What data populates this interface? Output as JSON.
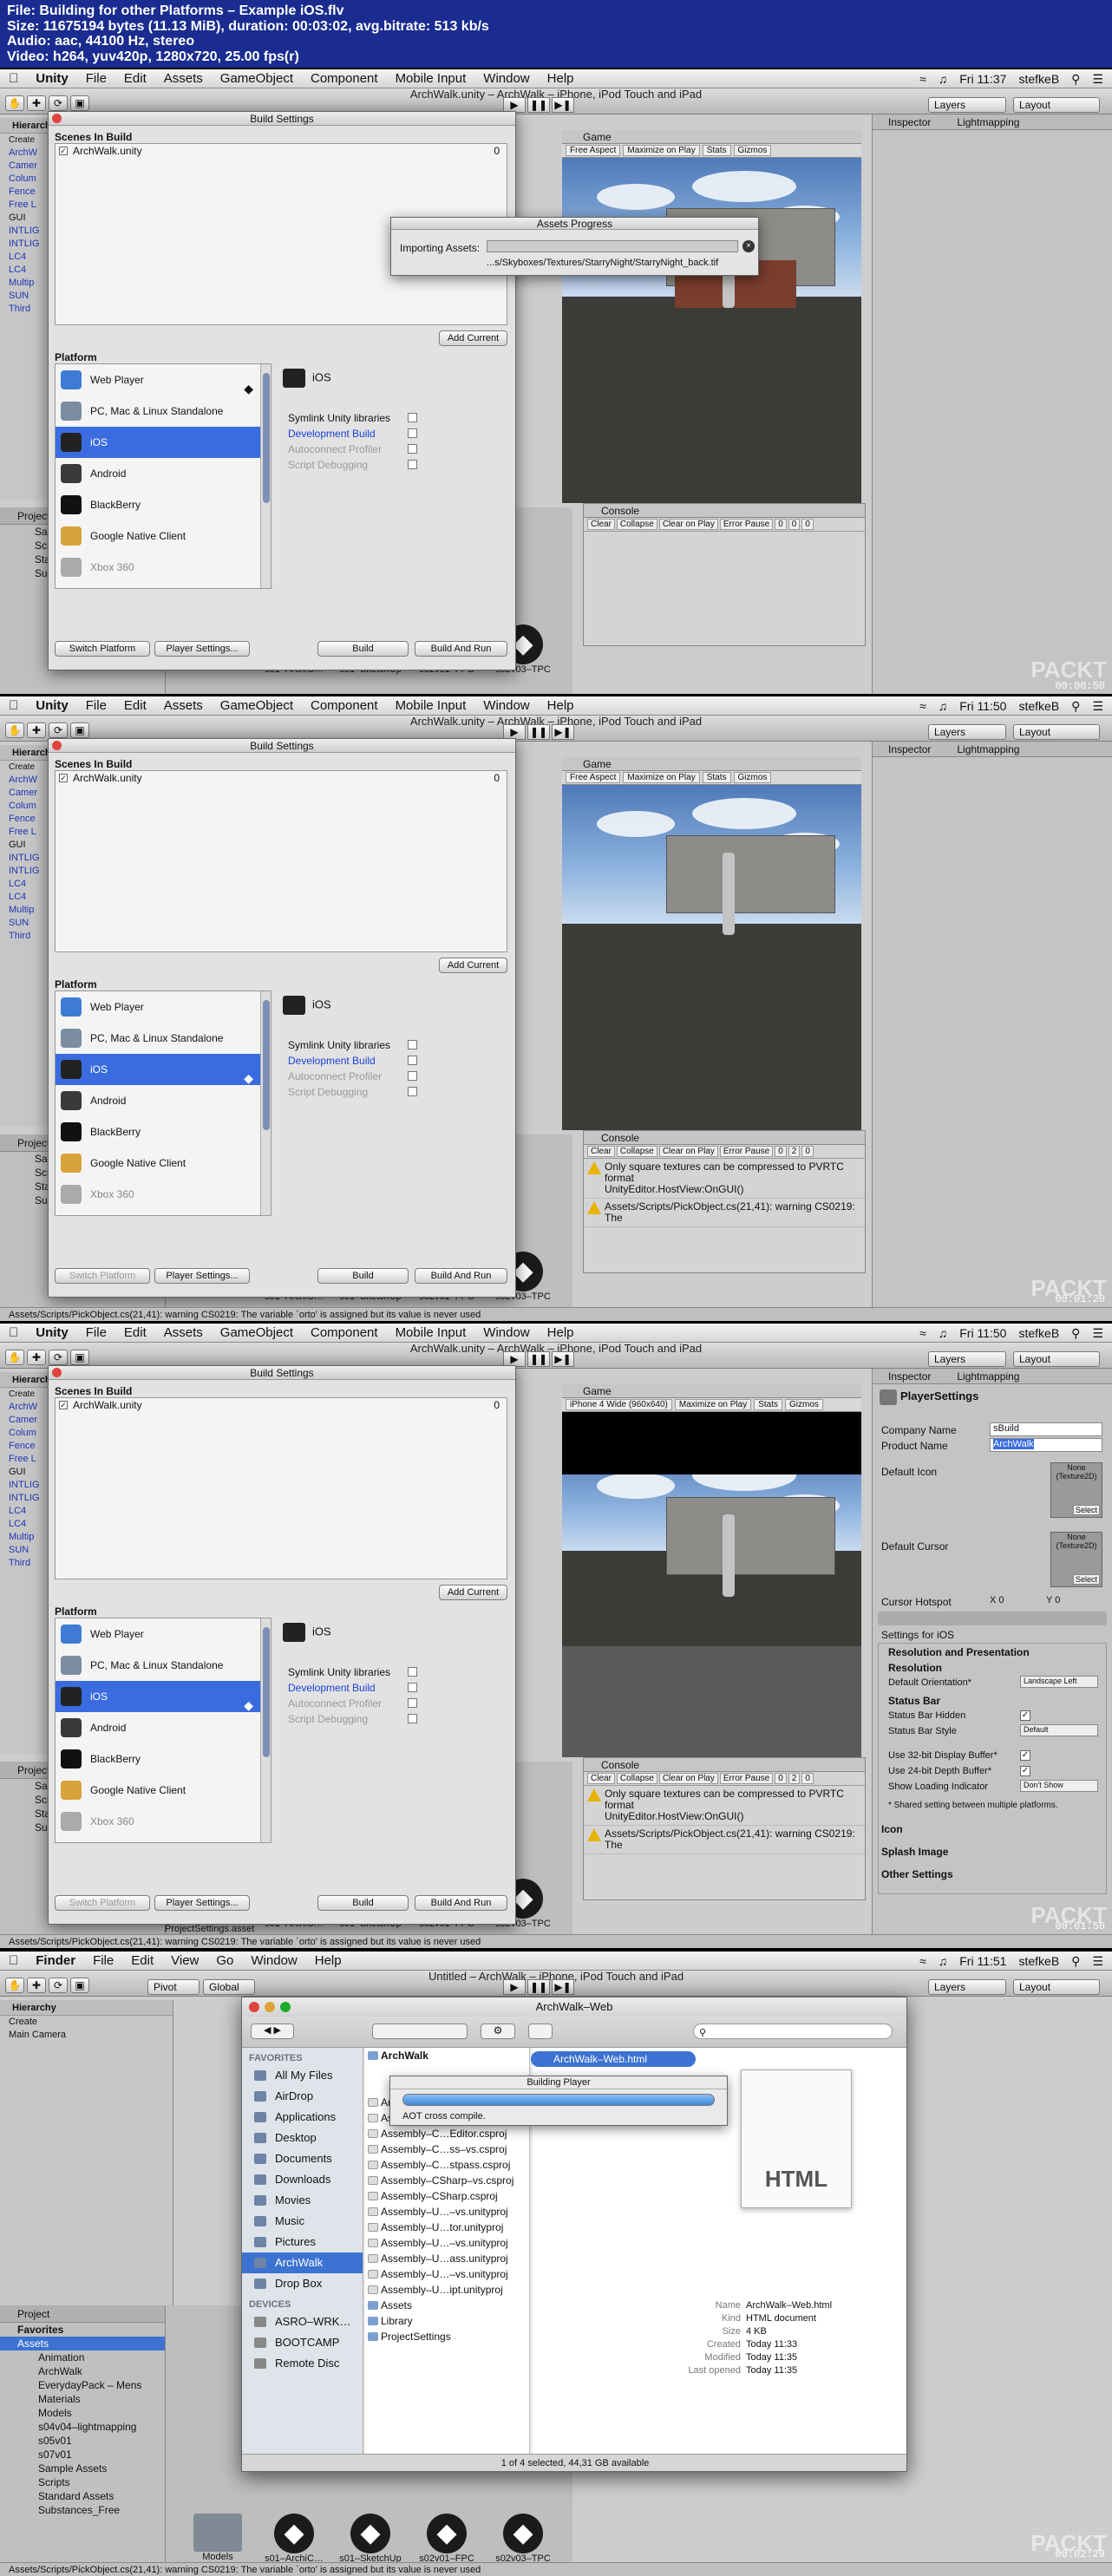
{
  "header": {
    "line1": "File: Building for other Platforms – Example iOS.flv",
    "line2": "Size: 11675194 bytes (11.13 MiB), duration: 00:03:02, avg.bitrate: 513 kb/s",
    "line3": "Audio: aac, 44100 Hz, stereo",
    "line4": "Video: h264, yuv420p, 1280x720, 25.00 fps(r)"
  },
  "menu": {
    "unity": [
      "Unity",
      "File",
      "Edit",
      "Assets",
      "GameObject",
      "Component",
      "Mobile Input",
      "Window",
      "Help"
    ],
    "finder": [
      "Finder",
      "File",
      "Edit",
      "View",
      "Go",
      "Window",
      "Help"
    ],
    "user": "stefkeB"
  },
  "frames": [
    {
      "time": "Fri 11:37",
      "timecode": "00:00:50",
      "window_title": "ArchWalk.unity – ArchWalk – iPhone, iPod Touch and iPad"
    },
    {
      "time": "Fri 11:50",
      "timecode": "00:01:20",
      "window_title": "ArchWalk.unity – ArchWalk – iPhone, iPod Touch and iPad"
    },
    {
      "time": "Fri 11:50",
      "timecode": "00:01:50",
      "window_title": "ArchWalk.unity – ArchWalk – iPhone, iPod Touch and iPad"
    },
    {
      "time": "Fri 11:51",
      "timecode": "00:02:29",
      "window_title": "Untitled – ArchWalk – iPhone, iPod Touch and iPad"
    }
  ],
  "toolbar": {
    "layers": "Layers",
    "layout": "Layout",
    "pivot": "Pivot",
    "global": "Global"
  },
  "hierarchy": {
    "title": "Hierarchy",
    "create": "Create",
    "items": [
      "ArchW",
      "Camer",
      "Colum",
      "Fence",
      "Free L",
      "GUI",
      "INTLIG",
      "INTLIG",
      "LC4",
      "LC4",
      "Multip",
      "SUN",
      "Third"
    ],
    "main_camera": "Main Camera"
  },
  "project": {
    "title": "Project",
    "create": "Create",
    "favorites": "Favorites",
    "tree": [
      "Assets",
      "Animation",
      "ArchWalk",
      "EverydayPack – Mens",
      "Materials",
      "Models",
      "s04v04–lightmapping",
      "s05v01",
      "s07v01",
      "Sample Assets",
      "Scripts",
      "Standard Assets",
      "Substances_Free"
    ],
    "tiles": [
      "Models",
      "s01–ArchiC…",
      "s01–SketchUp",
      "s02v01–FPC",
      "s02v03–TPC"
    ],
    "selected_asset": "ProjectSettings.asset",
    "anim_tile": "Animation",
    "arch_tile": "ArchWalk",
    "every_tile": "EverydayPa…",
    "mat_tile": "Materials",
    "mod_tile": "Models"
  },
  "game": {
    "title": "Game",
    "aspect1": "Free Aspect",
    "aspect2": "iPhone 4 Wide (960x640)",
    "buttons": [
      "Maximize on Play",
      "Stats",
      "Gizmos"
    ]
  },
  "console": {
    "title": "Console",
    "buttons": [
      "Clear",
      "Collapse",
      "Clear on Play",
      "Error Pause"
    ],
    "counts": [
      "0",
      "0",
      "0"
    ],
    "counts2": [
      "0",
      "2",
      "0"
    ],
    "msg1": "Only square textures can be compressed to PVRTC format",
    "msg1b": "UnityEditor.HostView:OnGUI()",
    "msg2": "Assets/Scripts/PickObject.cs(21,41): warning CS0219: The"
  },
  "inspector": {
    "title": "Inspector",
    "lightmapping": "Lightmapping",
    "player_settings": "PlayerSettings",
    "company_label": "Company Name",
    "company": "sBuild",
    "product_label": "Product Name",
    "product": "ArchWalk",
    "default_icon": "Default Icon",
    "default_cursor": "Default Cursor",
    "none_tex": "None (Texture2D)",
    "select": "Select",
    "cursor_hotspot": "Cursor Hotspot",
    "hx": "0",
    "hy": "0",
    "settings_for": "Settings for iOS",
    "resolution_pres": "Resolution and Presentation",
    "resolution": "Resolution",
    "orientation_label": "Default Orientation*",
    "orientation": "Landscape Left",
    "status_bar": "Status Bar",
    "status_hidden": "Status Bar Hidden",
    "status_style": "Status Bar Style",
    "style_value": "Default",
    "use32": "Use 32-bit Display Buffer*",
    "use24": "Use 24-bit Depth Buffer*",
    "loading": "Show Loading Indicator",
    "loading_value": "Don't Show",
    "shared": "* Shared setting between multiple platforms.",
    "icon": "Icon",
    "splash": "Splash Image",
    "other": "Other Settings"
  },
  "build": {
    "title": "Build Settings",
    "scenes_header": "Scenes In Build",
    "scene": "ArchWalk.unity",
    "scene_index": "0",
    "add_current": "Add Current",
    "platform_header": "Platform",
    "platforms": [
      "Web Player",
      "PC, Mac & Linux Standalone",
      "iOS",
      "Android",
      "BlackBerry",
      "Google Native Client",
      "Xbox 360"
    ],
    "selected_platform": "iOS",
    "options": [
      "Symlink Unity libraries",
      "Development Build",
      "Autoconnect Profiler",
      "Script Debugging"
    ],
    "switch_platform": "Switch Platform",
    "player_settings": "Player Settings...",
    "build": "Build",
    "build_and_run": "Build And Run"
  },
  "progress": {
    "title": "Assets Progress",
    "label": "Importing Assets:",
    "path": "...s/Skyboxes/Textures/StarryNight/StarryNight_back.tif"
  },
  "statusbar": {
    "text": "Assets/Scripts/PickObject.cs(21,41): warning CS0219: The variable `orto' is assigned but its value is never used"
  },
  "finder": {
    "title": "ArchWalk–Web",
    "favorites_header": "FAVORITES",
    "favorites": [
      "All My Files",
      "AirDrop",
      "Applications",
      "Desktop",
      "Documents",
      "Downloads",
      "Movies",
      "Music",
      "Pictures",
      "ArchWalk",
      "Drop Box"
    ],
    "devices_header": "DEVICES",
    "devices": [
      "ASRO–WRK…",
      "BOOTCAMP",
      "Remote Disc"
    ],
    "column1_title": "ArchWalk",
    "column1": [
      "ArchWalk.userprefs",
      "Assembly–C…tor–vs.csproj",
      "Assembly–C…Editor.csproj",
      "Assembly–C…ss–vs.csproj",
      "Assembly–C…stpass.csproj",
      "Assembly–CSharp–vs.csproj",
      "Assembly–CSharp.csproj",
      "Assembly–U…–vs.unityproj",
      "Assembly–U…tor.unityproj",
      "Assembly–U…–vs.unityproj",
      "Assembly–U…ass.unityproj",
      "Assembly–U…–vs.unityproj",
      "Assembly–U…ipt.unityproj",
      "Assets",
      "Library",
      "ProjectSettings"
    ],
    "selected_file": "ArchWalk–Web.html",
    "doc_label": "HTML",
    "info": [
      [
        "Name",
        "ArchWalk–Web.html"
      ],
      [
        "Kind",
        "HTML document"
      ],
      [
        "Size",
        "4 KB"
      ],
      [
        "Created",
        "Today 11:33"
      ],
      [
        "Modified",
        "Today 11:35"
      ],
      [
        "Last opened",
        "Today 11:35"
      ]
    ],
    "status": "1 of 4 selected, 44,31 GB available",
    "building": "Building Player",
    "aot": "AOT cross compile."
  },
  "watermark": "PACKT"
}
